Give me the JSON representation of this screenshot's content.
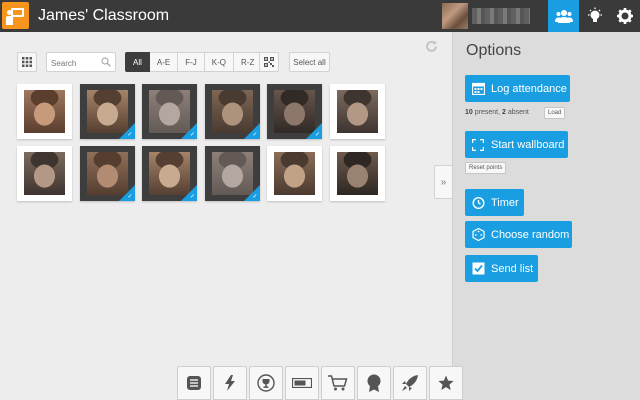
{
  "header": {
    "title": "James' Classroom",
    "icons": [
      "whiteboard-logo-icon",
      "students-icon",
      "ideas-icon",
      "gear-icon"
    ]
  },
  "toolbar": {
    "search_placeholder": "Search",
    "filters": [
      "All",
      "A-E",
      "F-J",
      "K-Q",
      "R-Z"
    ],
    "active_filter": "All",
    "select_all_label": "Select all"
  },
  "roster": {
    "rows": 2,
    "cols": 6,
    "students": [
      {
        "selected": false
      },
      {
        "selected": true
      },
      {
        "selected": true
      },
      {
        "selected": true
      },
      {
        "selected": true
      },
      {
        "selected": false
      },
      {
        "selected": false
      },
      {
        "selected": true
      },
      {
        "selected": true
      },
      {
        "selected": true
      },
      {
        "selected": false
      },
      {
        "selected": false
      }
    ]
  },
  "options": {
    "title": "Options",
    "log_attendance_label": "Log attendance",
    "present_count": "10",
    "present_text": " present, ",
    "absent_count": "2",
    "absent_text": " absent",
    "load_label": "Load",
    "start_wallboard_label": "Start wallboard",
    "reset_points_label": "Reset points",
    "timer_label": "Timer",
    "choose_random_label": "Choose random",
    "send_list_label": "Send list"
  },
  "dock": {
    "items": [
      "list-icon",
      "lightning-icon",
      "trophy-icon",
      "progress-bar-icon",
      "cart-icon",
      "badge-icon",
      "rocket-icon",
      "star-icon"
    ]
  },
  "colors": {
    "accent": "#1a9ee2",
    "brand": "#f7941d",
    "topbar": "#3a3a3a"
  }
}
